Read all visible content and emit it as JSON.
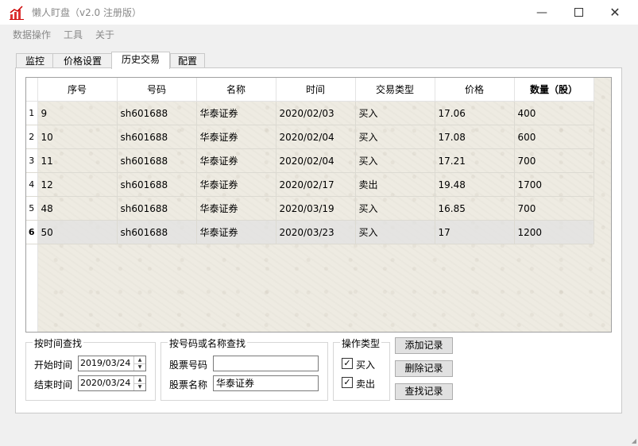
{
  "window": {
    "title": "懒人盯盘（v2.0 注册版）",
    "minimize_icon": "minimize-icon",
    "maximize_icon": "maximize-icon",
    "close_icon": "close-icon"
  },
  "menu": [
    "数据操作",
    "工具",
    "关于"
  ],
  "tabs": [
    {
      "label": "监控",
      "active": false
    },
    {
      "label": "价格设置",
      "active": false
    },
    {
      "label": "历史交易",
      "active": true
    },
    {
      "label": "配置",
      "active": false
    }
  ],
  "table": {
    "headers": [
      "序号",
      "号码",
      "名称",
      "时间",
      "交易类型",
      "价格",
      "数量（股）"
    ],
    "rows": [
      {
        "num": "1",
        "cells": [
          "9",
          "sh601688",
          "华泰证券",
          "2020/02/03",
          "买入",
          "17.06",
          "400"
        ]
      },
      {
        "num": "2",
        "cells": [
          "10",
          "sh601688",
          "华泰证券",
          "2020/02/04",
          "买入",
          "17.08",
          "600"
        ]
      },
      {
        "num": "3",
        "cells": [
          "11",
          "sh601688",
          "华泰证券",
          "2020/02/04",
          "买入",
          "17.21",
          "700"
        ]
      },
      {
        "num": "4",
        "cells": [
          "12",
          "sh601688",
          "华泰证券",
          "2020/02/17",
          "卖出",
          "19.48",
          "1700"
        ]
      },
      {
        "num": "5",
        "cells": [
          "48",
          "sh601688",
          "华泰证券",
          "2020/03/19",
          "买入",
          "16.85",
          "700"
        ]
      },
      {
        "num": "6",
        "cells": [
          "50",
          "sh601688",
          "华泰证券",
          "2020/03/23",
          "买入",
          "17",
          "1200"
        ],
        "selected": true
      }
    ]
  },
  "time_search": {
    "title": "按时间查找",
    "start_label": "开始时间",
    "start_value": "2019/03/24",
    "end_label": "结束时间",
    "end_value": "2020/03/24"
  },
  "code_search": {
    "title": "按号码或名称查找",
    "code_label": "股票号码",
    "code_value": "",
    "name_label": "股票名称",
    "name_value": "华泰证券"
  },
  "op_type": {
    "title": "操作类型",
    "buy_label": "买入",
    "buy_checked": true,
    "sell_label": "卖出",
    "sell_checked": true
  },
  "buttons": {
    "add": "添加记录",
    "delete": "删除记录",
    "find": "查找记录"
  }
}
